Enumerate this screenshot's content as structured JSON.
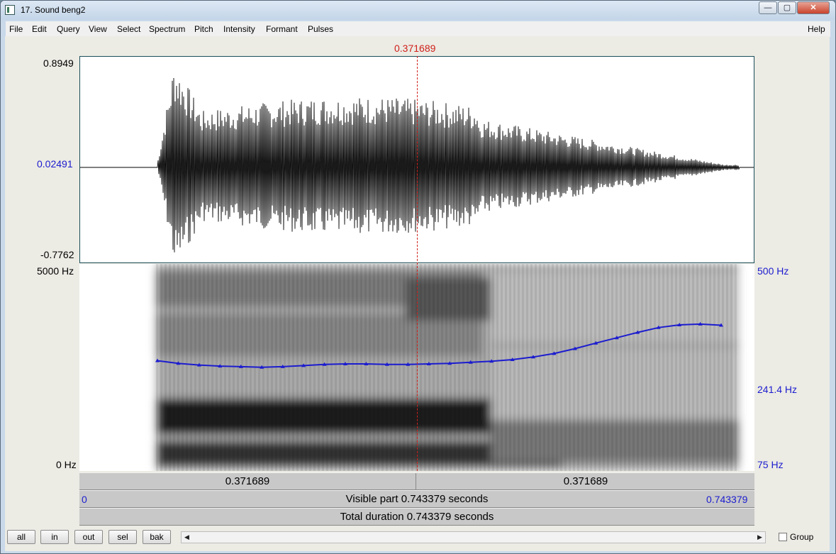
{
  "window": {
    "title": "17. Sound beng2",
    "controls": {
      "minimize": "—",
      "maximize": "▢",
      "close": "✕"
    }
  },
  "menu": {
    "items": [
      "File",
      "Edit",
      "Query",
      "View",
      "Select",
      "Spectrum",
      "Pitch",
      "Intensity",
      "Formant",
      "Pulses"
    ],
    "help": "Help"
  },
  "cursor": {
    "time_label": "0.371689"
  },
  "waveform": {
    "y_max": "0.8949",
    "y_mid": "0.02491",
    "y_min": "-0.7762"
  },
  "spectrogram": {
    "freq_top": "5000 Hz",
    "freq_bottom": "0 Hz",
    "pitch_top": "500 Hz",
    "pitch_mid": "241.4 Hz",
    "pitch_bottom": "75 Hz"
  },
  "time_bars": {
    "left_segment": "0.371689",
    "right_segment": "0.371689",
    "visible_start": "0",
    "visible_text": "Visible part 0.743379 seconds",
    "visible_end": "0.743379",
    "total_text": "Total duration 0.743379 seconds"
  },
  "bottom_buttons": [
    "all",
    "in",
    "out",
    "sel",
    "bak"
  ],
  "group_label": "Group",
  "colors": {
    "cursor": "#d0201a",
    "pitch": "#1c1ccf",
    "axis_blue": "#1c1ccf"
  },
  "pitch_contour_hz": [
    [
      0.0,
      206
    ],
    [
      0.025,
      201
    ],
    [
      0.05,
      198
    ],
    [
      0.075,
      196
    ],
    [
      0.1,
      195
    ],
    [
      0.125,
      194
    ],
    [
      0.15,
      195
    ],
    [
      0.175,
      197
    ],
    [
      0.2,
      199
    ],
    [
      0.225,
      200
    ],
    [
      0.25,
      200
    ],
    [
      0.275,
      199
    ],
    [
      0.3,
      199
    ],
    [
      0.325,
      200
    ],
    [
      0.35,
      201
    ],
    [
      0.375,
      203
    ],
    [
      0.4,
      205
    ],
    [
      0.425,
      208
    ],
    [
      0.45,
      213
    ],
    [
      0.475,
      220
    ],
    [
      0.5,
      230
    ],
    [
      0.525,
      242
    ],
    [
      0.55,
      254
    ],
    [
      0.575,
      267
    ],
    [
      0.6,
      279
    ],
    [
      0.625,
      286
    ],
    [
      0.65,
      288
    ],
    [
      0.675,
      285
    ]
  ]
}
